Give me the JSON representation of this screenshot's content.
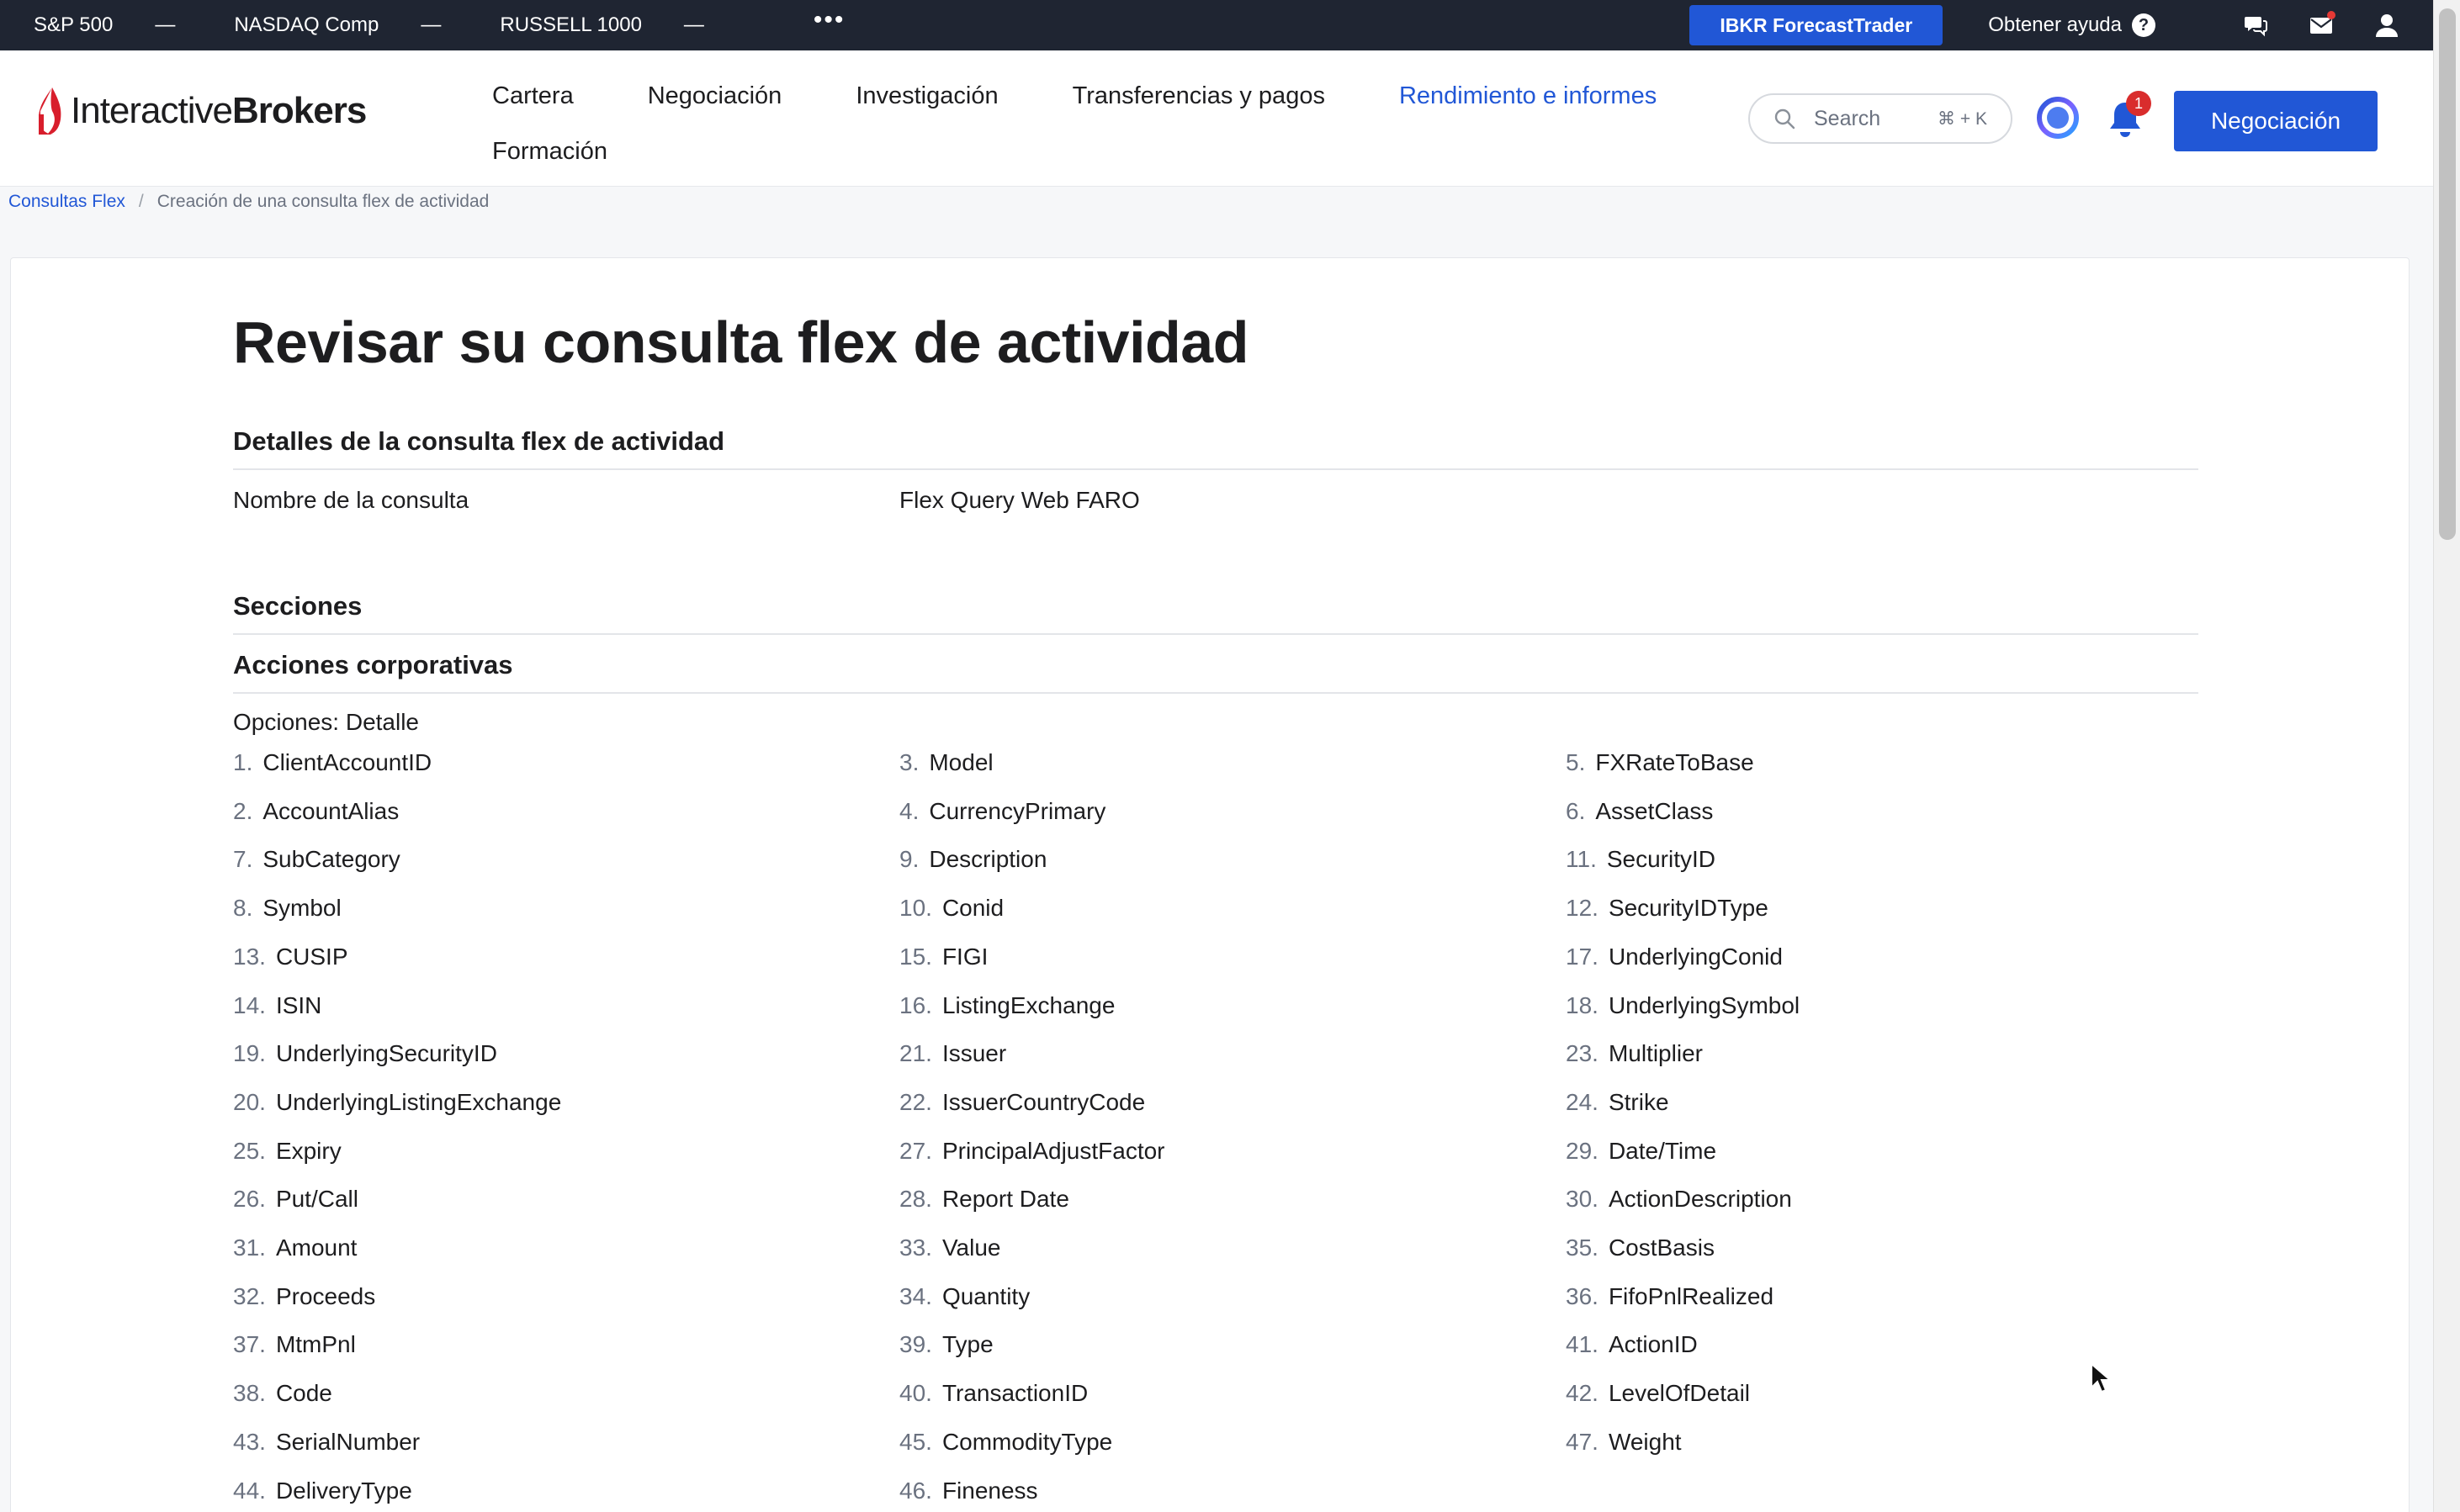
{
  "ticker": {
    "items": [
      {
        "name": "S&P 500",
        "value": "—"
      },
      {
        "name": "NASDAQ Comp",
        "value": "—"
      },
      {
        "name": "RUSSELL 1000",
        "value": "—"
      }
    ],
    "more": "•••",
    "forecast_button": "IBKR ForecastTrader",
    "help_label": "Obtener ayuda",
    "help_glyph": "?"
  },
  "header": {
    "brand_light": "Interactive",
    "brand_bold": "Brokers",
    "nav": [
      "Cartera",
      "Negociación",
      "Investigación",
      "Transferencias y pagos",
      "Rendimiento e informes",
      "Formación"
    ],
    "search_placeholder": "Search",
    "search_shortcut": "⌘ + K",
    "notifications_count": "1",
    "trade_button": "Negociación",
    "accent_color": "#2157d6"
  },
  "breadcrumb": {
    "parent": "Consultas Flex",
    "separator": "/",
    "current": "Creación de una consulta flex de actividad"
  },
  "page": {
    "title": "Revisar su consulta flex de actividad",
    "details_heading": "Detalles de la consulta flex de actividad",
    "query_name_label": "Nombre de la consulta",
    "query_name_value": "Flex Query Web FARO",
    "sections_heading": "Secciones",
    "section_name": "Acciones corporativas",
    "options_label": "Opciones: Detalle"
  },
  "fields": [
    [
      "1.",
      "ClientAccountID"
    ],
    [
      "3.",
      "Model"
    ],
    [
      "5.",
      "FXRateToBase"
    ],
    [
      "2.",
      "AccountAlias"
    ],
    [
      "4.",
      "CurrencyPrimary"
    ],
    [
      "6.",
      "AssetClass"
    ],
    [
      "7.",
      "SubCategory"
    ],
    [
      "9.",
      "Description"
    ],
    [
      "11.",
      "SecurityID"
    ],
    [
      "8.",
      "Symbol"
    ],
    [
      "10.",
      "Conid"
    ],
    [
      "12.",
      "SecurityIDType"
    ],
    [
      "13.",
      "CUSIP"
    ],
    [
      "15.",
      "FIGI"
    ],
    [
      "17.",
      "UnderlyingConid"
    ],
    [
      "14.",
      "ISIN"
    ],
    [
      "16.",
      "ListingExchange"
    ],
    [
      "18.",
      "UnderlyingSymbol"
    ],
    [
      "19.",
      "UnderlyingSecurityID"
    ],
    [
      "21.",
      "Issuer"
    ],
    [
      "23.",
      "Multiplier"
    ],
    [
      "20.",
      "UnderlyingListingExchange"
    ],
    [
      "22.",
      "IssuerCountryCode"
    ],
    [
      "24.",
      "Strike"
    ],
    [
      "25.",
      "Expiry"
    ],
    [
      "27.",
      "PrincipalAdjustFactor"
    ],
    [
      "29.",
      "Date/Time"
    ],
    [
      "26.",
      "Put/Call"
    ],
    [
      "28.",
      "Report Date"
    ],
    [
      "30.",
      "ActionDescription"
    ],
    [
      "31.",
      "Amount"
    ],
    [
      "33.",
      "Value"
    ],
    [
      "35.",
      "CostBasis"
    ],
    [
      "32.",
      "Proceeds"
    ],
    [
      "34.",
      "Quantity"
    ],
    [
      "36.",
      "FifoPnlRealized"
    ],
    [
      "37.",
      "MtmPnl"
    ],
    [
      "39.",
      "Type"
    ],
    [
      "41.",
      "ActionID"
    ],
    [
      "38.",
      "Code"
    ],
    [
      "40.",
      "TransactionID"
    ],
    [
      "42.",
      "LevelOfDetail"
    ],
    [
      "43.",
      "SerialNumber"
    ],
    [
      "45.",
      "CommodityType"
    ],
    [
      "47.",
      "Weight"
    ],
    [
      "44.",
      "DeliveryType"
    ],
    [
      "46.",
      "Fineness"
    ]
  ]
}
